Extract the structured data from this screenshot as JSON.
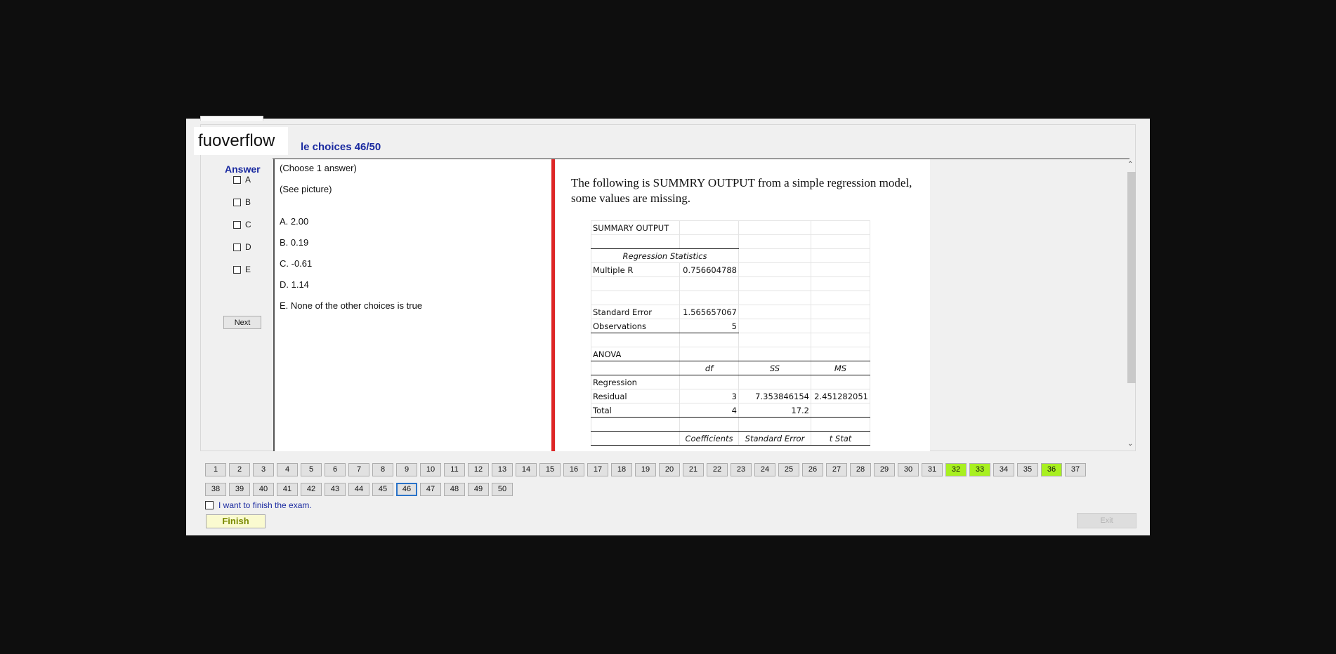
{
  "watermark": "fuoverflow",
  "section_title": "le choices 46/50",
  "answer_panel": {
    "heading": "Answer",
    "options": [
      "A",
      "B",
      "C",
      "D",
      "E"
    ],
    "next_label": "Next"
  },
  "question": {
    "instruction": "(Choose 1 answer)",
    "see_picture": "(See picture)",
    "choices": [
      "A.  2.00",
      "B.  0.19",
      "C.  -0.61",
      "D.  1.14",
      "E.  None of the other choices is true"
    ]
  },
  "picture": {
    "caption": "The following is SUMMRY OUTPUT from a simple regression model, some values are missing.",
    "sheet": {
      "summary_output": "SUMMARY OUTPUT",
      "regression_statistics": "Regression Statistics",
      "multiple_r_label": "Multiple R",
      "multiple_r_value": "0.756604788",
      "standard_error_label": "Standard Error",
      "standard_error_value": "1.565657067",
      "observations_label": "Observations",
      "observations_value": "5",
      "anova_label": "ANOVA",
      "anova_headers": [
        "df",
        "SS",
        "MS"
      ],
      "regression_label": "Regression",
      "residual_label": "Residual",
      "residual_df": "3",
      "residual_ss": "7.353846154",
      "residual_ms": "2.451282051",
      "total_label": "Total",
      "total_df": "4",
      "total_ss": "17.2",
      "coef_headers": [
        "Coefficients",
        "Standard Error",
        "t Stat"
      ]
    }
  },
  "scrollbar": {
    "up_icon": "chevron-up-icon",
    "down_icon": "chevron-down-icon"
  },
  "navigation": {
    "questions": [
      "1",
      "2",
      "3",
      "4",
      "5",
      "6",
      "7",
      "8",
      "9",
      "10",
      "11",
      "12",
      "13",
      "14",
      "15",
      "16",
      "17",
      "18",
      "19",
      "20",
      "21",
      "22",
      "23",
      "24",
      "25",
      "26",
      "27",
      "28",
      "29",
      "30",
      "31",
      "32",
      "33",
      "34",
      "35",
      "36",
      "37",
      "38",
      "39",
      "40",
      "41",
      "42",
      "43",
      "44",
      "45",
      "46",
      "47",
      "48",
      "49",
      "50"
    ],
    "answered": [
      "32",
      "33",
      "36"
    ],
    "current": "46"
  },
  "footer": {
    "finish_check_label": "I want to finish the exam.",
    "finish_label": "Finish",
    "exit_label": "Exit"
  },
  "colors": {
    "accent": "#1a2aa0",
    "answered": "#a8f020",
    "current_border": "#2a73c9",
    "divider_red": "#dd2525"
  }
}
